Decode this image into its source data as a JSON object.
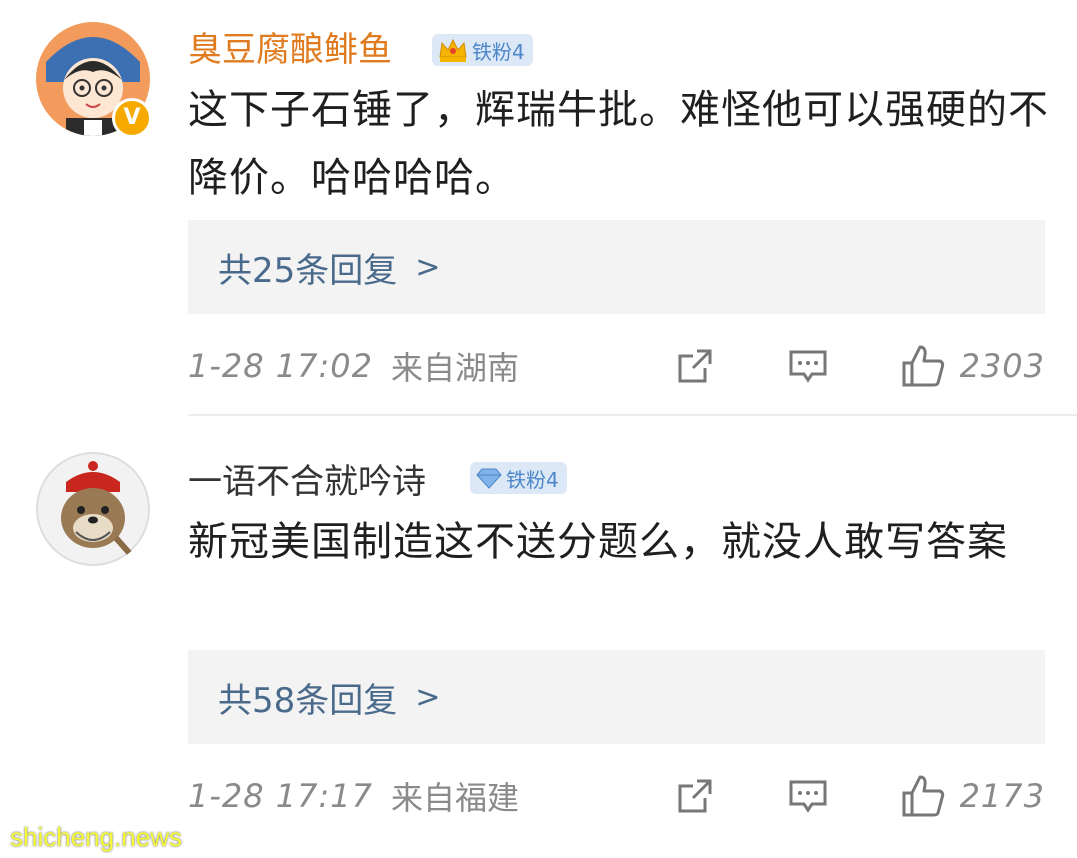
{
  "comments": [
    {
      "username": "臭豆腐酿鲱鱼",
      "username_color": "#e07b1f",
      "fan_badge": "铁粉4",
      "fan_icon": "crown-icon",
      "verified": "V",
      "text": "这下子石锤了，辉瑞牛批。难怪他可以强硬的不降价。哈哈哈哈。",
      "replies": "共25条回复",
      "time": "1-28 17:02",
      "location": "来自湖南",
      "likes": "2303"
    },
    {
      "username": "一语不合就吟诗",
      "username_color": "#333333",
      "fan_badge": "铁粉4",
      "fan_icon": "diamond-icon",
      "text": "新冠美国制造这不送分题么，就没人敢写答案",
      "replies": "共58条回复",
      "time": "1-28 17:17",
      "location": "来自福建",
      "likes": "2173"
    }
  ],
  "watermark": "shicheng.news"
}
